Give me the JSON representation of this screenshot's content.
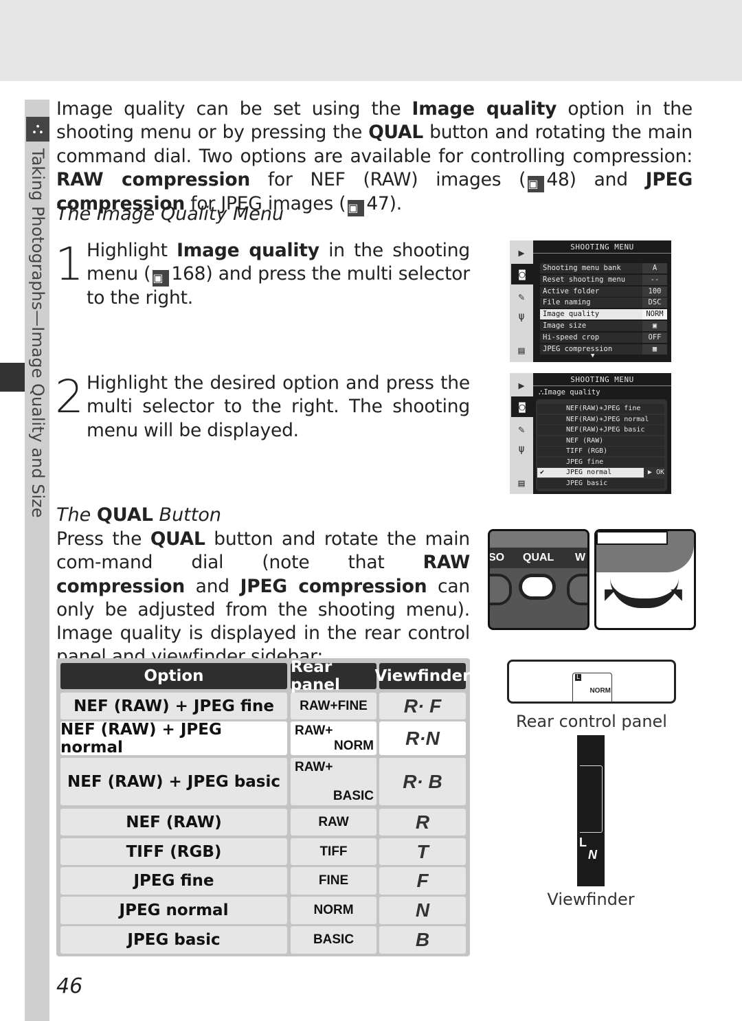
{
  "sidebar": {
    "section_title": "Taking Photographs—Image Quality and Size",
    "icon": "camera-menu-icon"
  },
  "intro": {
    "s1": "Image quality can be set using the ",
    "b1": "Image quality",
    "s2": " option in the shooting menu or by pressing the ",
    "b2": "QUAL",
    "s3": " button and rotating the main command dial. Two options are available for controlling compression: ",
    "b3": "RAW compression",
    "s4": " for NEF (RAW) images (",
    "ref1": "48",
    "s5": ") and ",
    "b4": "JPEG compression",
    "s6": " for JPEG images (",
    "ref2": "47",
    "s7": ")."
  },
  "section1": {
    "heading": "The Image Quality Menu"
  },
  "step1": {
    "number": "1",
    "s1": "Highlight ",
    "b1": "Image quality",
    "s2": " in the shooting menu (",
    "ref": "168",
    "s3": ") and press the multi selector to the right."
  },
  "step2": {
    "number": "2",
    "text": "Highlight the desired option and press the multi selector to the right.  The shooting menu will be displayed."
  },
  "menu1": {
    "title": "SHOOTING MENU",
    "rows": [
      {
        "label": "Shooting menu bank",
        "value": "A"
      },
      {
        "label": "Reset shooting menu",
        "value": "--"
      },
      {
        "label": "Active folder",
        "value": "100"
      },
      {
        "label": "File naming",
        "value": "DSC"
      },
      {
        "label": "Image quality",
        "value": "NORM",
        "selected": true
      },
      {
        "label": "Image size",
        "value": "▣"
      },
      {
        "label": "Hi-speed crop",
        "value": "OFF"
      },
      {
        "label": "JPEG compression",
        "value": "▦"
      }
    ]
  },
  "menu2": {
    "title": "SHOOTING MENU",
    "subtitle": "Image quality",
    "options": [
      "NEF(RAW)+JPEG fine",
      "NEF(RAW)+JPEG normal",
      "NEF(RAW)+JPEG basic",
      "NEF  (RAW)",
      "TIFF (RGB)",
      "JPEG fine",
      "JPEG normal",
      "JPEG basic"
    ],
    "selected_index": 6,
    "check": "✔",
    "ok_label": "▶ OK"
  },
  "section2": {
    "heading_pre": "The ",
    "heading_bold": "QUAL",
    "heading_post": " Button",
    "s1": "Press the ",
    "b1": "QUAL",
    "s2": " button and rotate the main com-mand dial (note that ",
    "b2": "RAW compression",
    "s3": " and ",
    "b3": "JPEG compression",
    "s4": " can only be adjusted from the shooting menu).  Image quality is displayed in the rear control panel and viewfinder sidebar:"
  },
  "camera_buttons": {
    "left": "SO",
    "middle": "QUAL",
    "right": "W"
  },
  "table": {
    "headers": [
      "Option",
      "Rear panel",
      "Viewfinder"
    ],
    "rows": [
      {
        "option": "NEF (RAW) + JPEG fine",
        "rear": "RAW+FINE",
        "vf": "R· F"
      },
      {
        "option": "NEF (RAW) + JPEG normal",
        "rear_top": "RAW+",
        "rear_bottom": "NORM",
        "vf": "R·N"
      },
      {
        "option": "NEF (RAW) + JPEG basic",
        "rear_top": "RAW+",
        "rear_bottom": "BASIC",
        "vf": "R· B"
      },
      {
        "option": "NEF (RAW)",
        "rear": "RAW",
        "vf": "R"
      },
      {
        "option": "TIFF (RGB)",
        "rear": "TIFF",
        "vf": "T"
      },
      {
        "option": "JPEG fine",
        "rear": "FINE",
        "vf": "F"
      },
      {
        "option": "JPEG normal",
        "rear": "NORM",
        "vf": "N"
      },
      {
        "option": "JPEG basic",
        "rear": "BASIC",
        "vf": "B"
      }
    ]
  },
  "rear_panel": {
    "display": "NORM",
    "size_icon": "L",
    "caption": "Rear control panel"
  },
  "viewfinder": {
    "size": "L",
    "quality": "N",
    "caption": "Viewfinder"
  },
  "page_number": "46"
}
